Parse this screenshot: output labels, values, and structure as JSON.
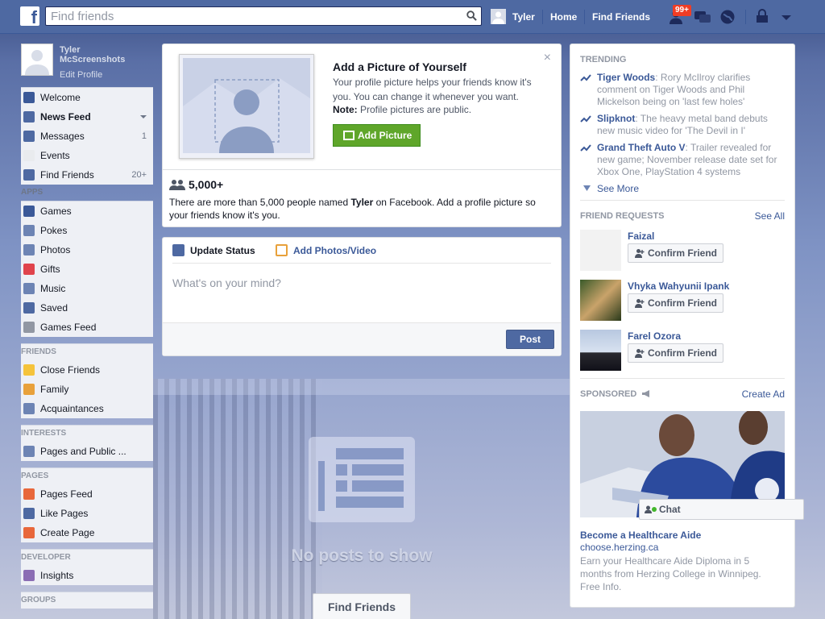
{
  "topbar": {
    "search_placeholder": "Find friends",
    "user_name": "Tyler",
    "home": "Home",
    "find_friends": "Find Friends",
    "friend_requests_badge": "99+"
  },
  "profile": {
    "name": "Tyler McScreenshots",
    "edit": "Edit Profile"
  },
  "nav": {
    "main": [
      {
        "label": "Welcome",
        "icon": "facebook-icon",
        "color": "#3b5998"
      },
      {
        "label": "News Feed",
        "icon": "news-feed-icon",
        "color": "#4e69a2"
      },
      {
        "label": "Messages",
        "icon": "messages-icon",
        "color": "#4e69a2",
        "count": "1"
      },
      {
        "label": "Events",
        "icon": "calendar-icon",
        "color": "#e9ebee"
      },
      {
        "label": "Find Friends",
        "icon": "friends-icon",
        "color": "#4e69a2",
        "count": "20+"
      }
    ],
    "apps_header": "APPS",
    "apps": [
      {
        "label": "Games",
        "icon": "games-icon",
        "color": "#3b5998"
      },
      {
        "label": "Pokes",
        "icon": "pokes-icon",
        "color": "#6d84b4"
      },
      {
        "label": "Photos",
        "icon": "photos-icon",
        "color": "#6d84b4"
      },
      {
        "label": "Gifts",
        "icon": "gift-icon",
        "color": "#e0434c"
      },
      {
        "label": "Music",
        "icon": "music-icon",
        "color": "#6d84b4"
      },
      {
        "label": "Saved",
        "icon": "bookmark-icon",
        "color": "#4e69a2"
      },
      {
        "label": "Games Feed",
        "icon": "controller-icon",
        "color": "#9197a3"
      }
    ],
    "friends_header": "FRIENDS",
    "friends": [
      {
        "label": "Close Friends",
        "icon": "star-icon",
        "color": "#f5c33b"
      },
      {
        "label": "Family",
        "icon": "house-icon",
        "color": "#e8a13b"
      },
      {
        "label": "Acquaintances",
        "icon": "list-icon",
        "color": "#6d84b4"
      }
    ],
    "interests_header": "INTERESTS",
    "interests": [
      {
        "label": "Pages and Public ...",
        "icon": "rss-icon",
        "color": "#6d84b4"
      }
    ],
    "pages_header": "PAGES",
    "pages": [
      {
        "label": "Pages Feed",
        "icon": "flag-icon",
        "color": "#e8673b"
      },
      {
        "label": "Like Pages",
        "icon": "thumbs-up-icon",
        "color": "#4e69a2"
      },
      {
        "label": "Create Page",
        "icon": "plus-icon",
        "color": "#e8673b"
      }
    ],
    "developer_header": "DEVELOPER",
    "developer": [
      {
        "label": "Insights",
        "icon": "chart-icon",
        "color": "#8b6db4"
      }
    ],
    "groups_header": "GROUPS"
  },
  "add_picture": {
    "title": "Add a Picture of Yourself",
    "desc": "Your profile picture helps your friends know it's you. You can change it whenever you want.",
    "note_label": "Note:",
    "note_text": " Profile pictures are public.",
    "button": "Add Picture",
    "close": "×",
    "count": "5,000+",
    "people_pre": "There are more than 5,000 people named ",
    "people_name": "Tyler",
    "people_post": " on Facebook. Add a profile picture so your friends know it's you."
  },
  "composer": {
    "tab_status": "Update Status",
    "tab_photos": "Add Photos/Video",
    "placeholder": "What's on your mind?",
    "post": "Post"
  },
  "empty": {
    "text": "No posts to show",
    "button": "Find Friends"
  },
  "trending": {
    "header": "TRENDING",
    "items": [
      {
        "topic": "Tiger Woods",
        "text": ": Rory McIlroy clarifies comment on Tiger Woods and Phil Mickelson being on 'last few holes'"
      },
      {
        "topic": "Slipknot",
        "text": ": The heavy metal band debuts new music video for 'The Devil in I'"
      },
      {
        "topic": "Grand Theft Auto V",
        "text": ": Trailer revealed for new game; November release date set for Xbox One, PlayStation 4 systems"
      }
    ],
    "see_more": "See More"
  },
  "friend_requests": {
    "header": "FRIEND REQUESTS",
    "see_all": "See All",
    "items": [
      {
        "name": "Faizal",
        "button": "Confirm Friend"
      },
      {
        "name": "Vhyka Wahyunii Ipank",
        "button": "Confirm Friend"
      },
      {
        "name": "Farel Ozora",
        "button": "Confirm Friend"
      }
    ]
  },
  "sponsored": {
    "header": "SPONSORED",
    "create_ad": "Create Ad",
    "title": "Become a Healthcare Aide",
    "url": "choose.herzing.ca",
    "desc": "Earn your Healthcare Aide Diploma in 5 months from Herzing College in Winnipeg. Free Info."
  },
  "chat": {
    "label": "Chat"
  }
}
